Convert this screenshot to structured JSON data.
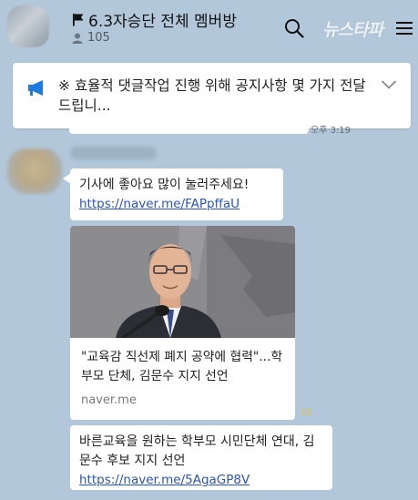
{
  "header": {
    "title": "6.3자승단 전체 멤버방",
    "member_count": "105",
    "watermark": "뉴스타파"
  },
  "notice": {
    "text": "※ 효율적 댓글작업 진행 위해 공지사항 몇 가지 전달드립니..."
  },
  "previous": {
    "time": "오후 3:19"
  },
  "messages": [
    {
      "text": "기사에 좋아요 많이 눌러주세요!",
      "link": "https://naver.me/FAPpffaU"
    },
    {
      "preview_title": "\"교육감 직선제 폐지 공약에 협력\"...학부모 단체, 김문수 지지 선언",
      "preview_domain": "naver.me",
      "unread": "15"
    },
    {
      "text": "바른교육을 원하는 학부모 시민단체 연대, 김문수 후보 지지 선언",
      "link": "https://naver.me/5AgaGP8V"
    }
  ],
  "colors": {
    "background": "#b2c7d9",
    "bubble": "#ffffff",
    "link": "#2a55b8",
    "unread": "#e8c23a",
    "notice_icon": "#1e7be0"
  },
  "icons": [
    "flag-icon",
    "person-icon",
    "search-icon",
    "menu-icon",
    "megaphone-icon",
    "chevron-down-icon"
  ]
}
